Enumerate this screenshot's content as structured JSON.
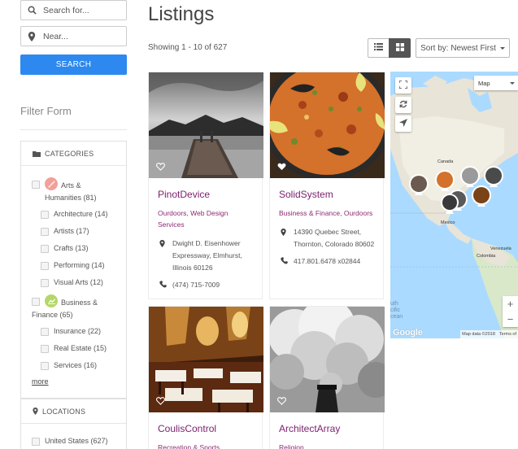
{
  "sidebar": {
    "search_placeholder": "Search for...",
    "near_placeholder": "Near...",
    "search_button": "SEARCH",
    "filter_title": "Filter Form",
    "categories": {
      "heading": "CATEGORIES",
      "items": [
        {
          "label_line1": "Arts &",
          "label_line2": "Humanities (81)",
          "badge_color": "#f2a09a",
          "badge_icon": "brush-icon"
        },
        {
          "label": "Architecture (14)"
        },
        {
          "label": "Artists (17)"
        },
        {
          "label": "Crafts (13)"
        },
        {
          "label": "Performing (14)"
        },
        {
          "label": "Visual Arts (12)"
        },
        {
          "label_line1": "Business &",
          "label_line2": "Finance (65)",
          "badge_color": "#b5d66a",
          "badge_icon": "chart-icon"
        },
        {
          "label": "Insurance (22)"
        },
        {
          "label": "Real Estate (15)"
        },
        {
          "label": "Services (16)"
        }
      ],
      "more": "more"
    },
    "locations": {
      "heading": "LOCATIONS",
      "items": [
        {
          "label": "United States (627)"
        }
      ]
    }
  },
  "header": {
    "title": "Listings",
    "showing": "Showing 1 - 10 of 627",
    "sort_label": "Sort by: Newest First"
  },
  "listings": [
    {
      "title": "PinotDevice",
      "categories": "Ourdoors, Web Design Services",
      "address": "Dwight D. Eisenhower Expressway, Elmhurst, Illinois 60126",
      "phone": "(474) 715-7009"
    },
    {
      "title": "SolidSystem",
      "categories": "Business & Finance, Ourdoors",
      "address": "14390 Quebec Street, Thornton, Colorado 80602",
      "phone": "417.801.6478 x02844"
    },
    {
      "title": "CoulisControl",
      "categories": "Recreation & Sports"
    },
    {
      "title": "ArchitectArray",
      "categories": "Religion"
    }
  ],
  "map": {
    "type_label": "Map",
    "labels": {
      "canada": "Canada",
      "mexico": "Mexico",
      "venezuela": "Venezuela",
      "colombia": "Colombia",
      "ocean": "uth cific cean"
    },
    "google": "Google",
    "map_data": "Map data ©2018",
    "terms": "Terms of"
  },
  "colors": {
    "accent": "#2d89ef",
    "listing_title": "#7a1f6b",
    "listing_category": "#8e2a74"
  }
}
